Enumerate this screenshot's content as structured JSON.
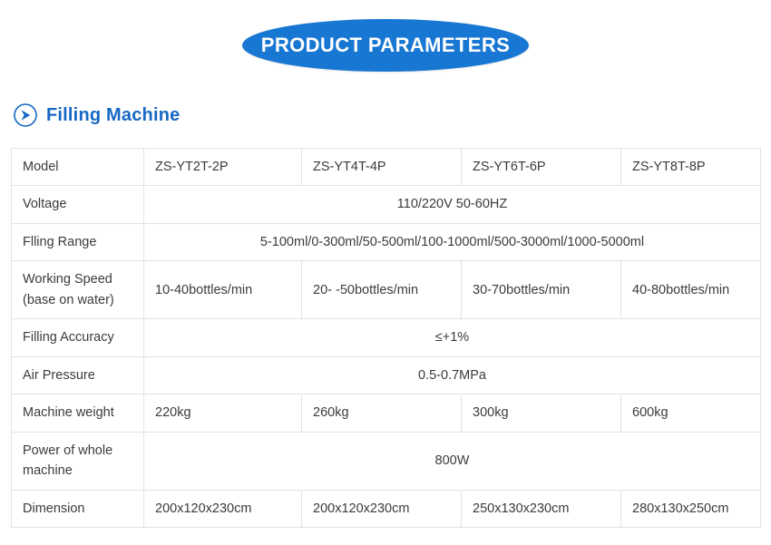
{
  "banner": {
    "title": "PRODUCT PARAMETERS",
    "color": "#1877d2",
    "text_color": "#ffffff"
  },
  "section": {
    "icon": "circle-arrow-right-icon",
    "title": "Filling Machine",
    "color": "#1668c4"
  },
  "table": {
    "border_color": "#e2e2e2",
    "text_color": "#3b3b3b",
    "column_count": 5,
    "rows": [
      {
        "label": "Model",
        "span": false,
        "values": [
          "ZS-YT2T-2P",
          "ZS-YT4T-4P",
          "ZS-YT6T-6P",
          "ZS-YT8T-8P"
        ]
      },
      {
        "label": "Voltage",
        "span": true,
        "value": "110/220V 50-60HZ"
      },
      {
        "label": "Flling Range",
        "span": true,
        "value": "5-100ml/0-300ml/50-500ml/100-1000ml/500-3000ml/1000-5000ml"
      },
      {
        "label": "Working Speed (base on water)",
        "span": false,
        "values": [
          "10-40bottles/min",
          "20- -50bottles/min",
          "30-70bottles/min",
          "40-80bottles/min"
        ]
      },
      {
        "label": "Filling Accuracy",
        "span": true,
        "value": "≤+1%"
      },
      {
        "label": "Air Pressure",
        "span": true,
        "value": "0.5-0.7MPa"
      },
      {
        "label": "Machine weight",
        "span": false,
        "values": [
          "220kg",
          "260kg",
          "300kg",
          "600kg"
        ]
      },
      {
        "label": "Power of whole machine",
        "span": true,
        "value": "800W"
      },
      {
        "label": "Dimension",
        "span": false,
        "values": [
          "200x120x230cm",
          "200x120x230cm",
          "250x130x230cm",
          "280x130x250cm"
        ]
      }
    ]
  }
}
